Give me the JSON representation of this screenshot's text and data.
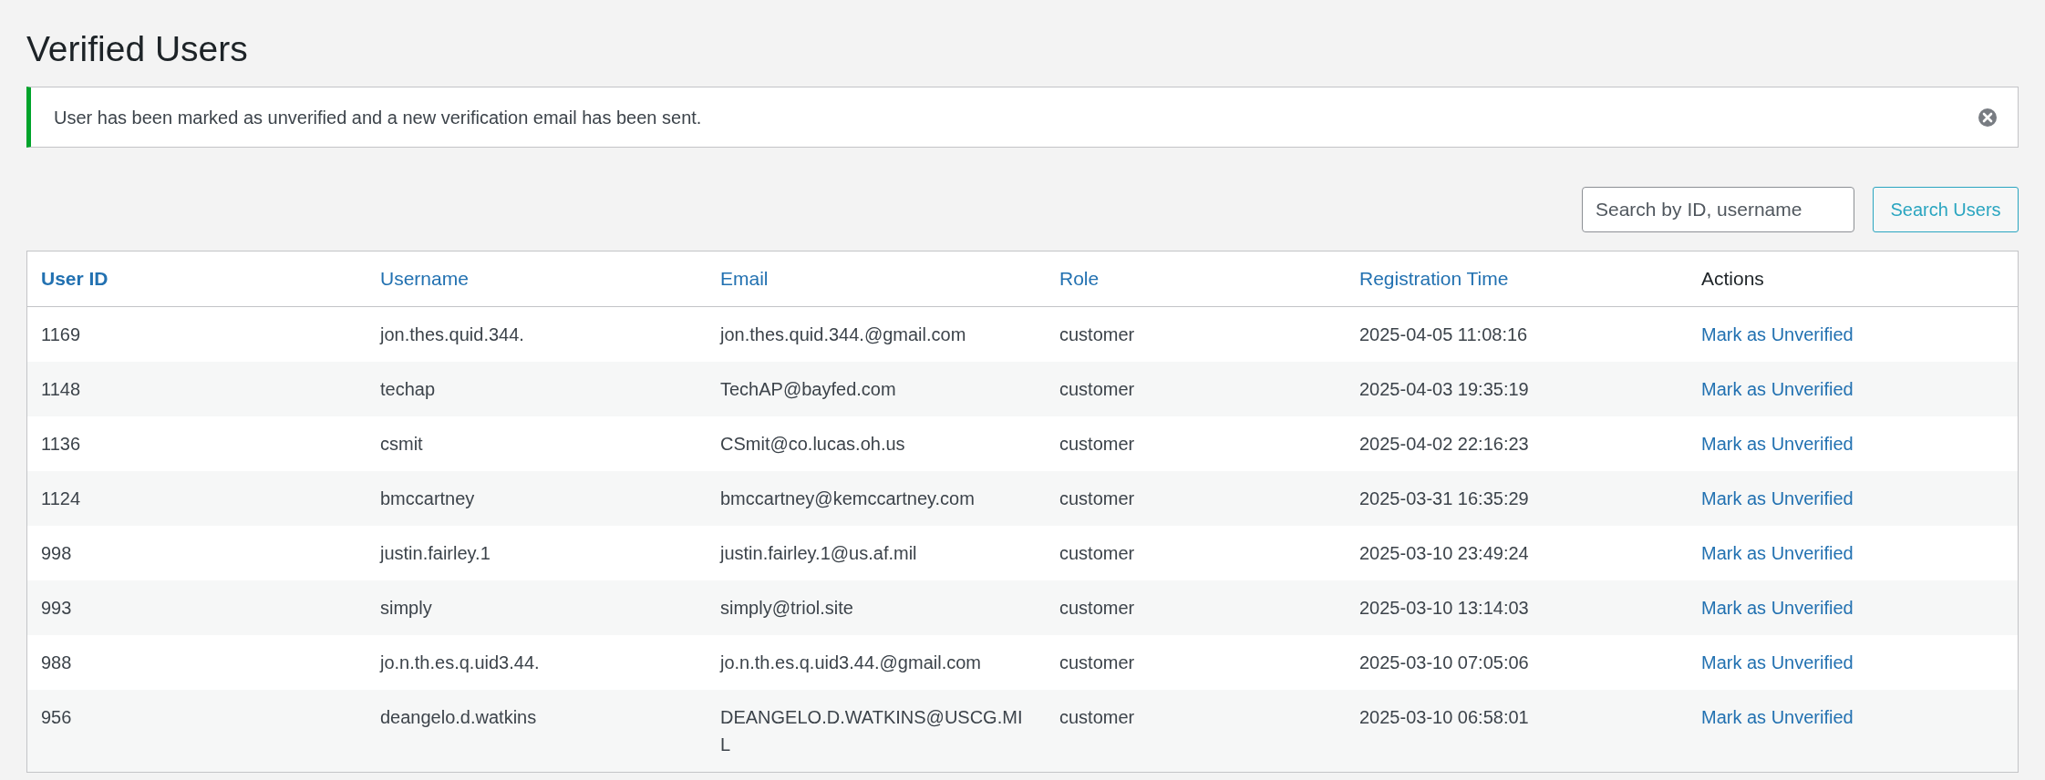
{
  "page": {
    "title": "Verified Users"
  },
  "notice": {
    "message": "User has been marked as unverified and a new verification email has been sent."
  },
  "search": {
    "placeholder": "Search by ID, username",
    "button": "Search Users"
  },
  "table": {
    "columns": [
      {
        "label": "User ID",
        "sortable": true,
        "sorted": true
      },
      {
        "label": "Username",
        "sortable": true,
        "sorted": false
      },
      {
        "label": "Email",
        "sortable": true,
        "sorted": false
      },
      {
        "label": "Role",
        "sortable": true,
        "sorted": false
      },
      {
        "label": "Registration Time",
        "sortable": true,
        "sorted": false
      },
      {
        "label": "Actions",
        "sortable": false,
        "sorted": false
      }
    ],
    "rows": [
      {
        "user_id": "1169",
        "username": "jon.thes.quid.344.",
        "email": "jon.thes.quid.344.@gmail.com",
        "role": "customer",
        "registered": "2025-04-05 11:08:16",
        "action": "Mark as Unverified"
      },
      {
        "user_id": "1148",
        "username": "techap",
        "email": "TechAP@bayfed.com",
        "role": "customer",
        "registered": "2025-04-03 19:35:19",
        "action": "Mark as Unverified"
      },
      {
        "user_id": "1136",
        "username": "csmit",
        "email": "CSmit@co.lucas.oh.us",
        "role": "customer",
        "registered": "2025-04-02 22:16:23",
        "action": "Mark as Unverified"
      },
      {
        "user_id": "1124",
        "username": "bmccartney",
        "email": "bmccartney@kemccartney.com",
        "role": "customer",
        "registered": "2025-03-31 16:35:29",
        "action": "Mark as Unverified"
      },
      {
        "user_id": "998",
        "username": "justin.fairley.1",
        "email": "justin.fairley.1@us.af.mil",
        "role": "customer",
        "registered": "2025-03-10 23:49:24",
        "action": "Mark as Unverified"
      },
      {
        "user_id": "993",
        "username": "simply",
        "email": "simply@triol.site",
        "role": "customer",
        "registered": "2025-03-10 13:14:03",
        "action": "Mark as Unverified"
      },
      {
        "user_id": "988",
        "username": "jo.n.th.es.q.uid3.44.",
        "email": "jo.n.th.es.q.uid3.44.@gmail.com",
        "role": "customer",
        "registered": "2025-03-10 07:05:06",
        "action": "Mark as Unverified"
      },
      {
        "user_id": "956",
        "username": "deangelo.d.watkins",
        "email": "DEANGELO.D.WATKINS@USCG.MIL",
        "role": "customer",
        "registered": "2025-03-10 06:58:01",
        "action": "Mark as Unverified"
      }
    ]
  }
}
